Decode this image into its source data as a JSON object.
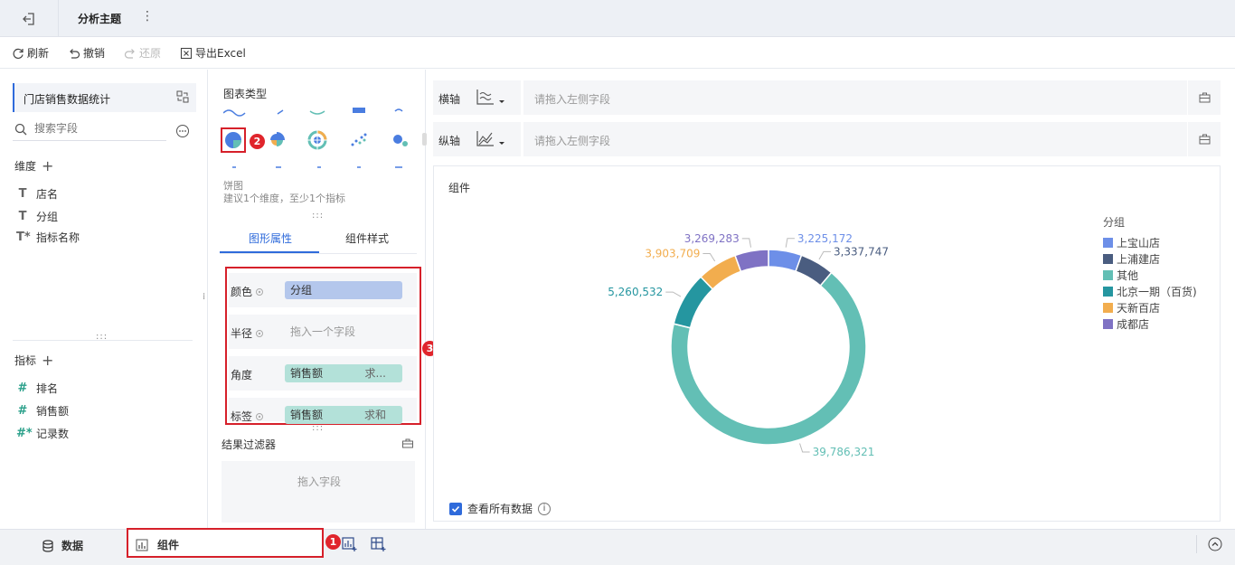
{
  "header": {
    "title": "分析主题",
    "more": "⋮"
  },
  "toolbar": {
    "refresh": "刷新",
    "undo": "撤销",
    "redo": "还原",
    "export": "导出Excel"
  },
  "left": {
    "dataset": "门店销售数据统计",
    "search_placeholder": "搜索字段",
    "dimensions_title": "维度",
    "dimensions": [
      {
        "icon": "T",
        "label": "店名"
      },
      {
        "icon": "T",
        "label": "分组"
      },
      {
        "icon": "T*",
        "label": "指标名称"
      }
    ],
    "metrics_title": "指标",
    "metrics": [
      {
        "icon": "#",
        "label": "排名"
      },
      {
        "icon": "#",
        "label": "销售额"
      },
      {
        "icon": "#*",
        "label": "记录数"
      }
    ]
  },
  "middle": {
    "chart_type_label": "图表类型",
    "selected_chart": "饼图",
    "chart_hint": "建议1个维度，至少1个指标",
    "tabs": [
      "图形属性",
      "组件样式"
    ],
    "props": [
      {
        "label": "颜色",
        "value": "分组",
        "agg": ""
      },
      {
        "label": "半径",
        "value": "拖入一个字段",
        "agg": ""
      },
      {
        "label": "角度",
        "value": "销售额",
        "agg": "求..."
      },
      {
        "label": "标签",
        "value": "销售额",
        "agg": "求和"
      }
    ],
    "filter_title": "结果过滤器",
    "filter_placeholder": "拖入字段",
    "badge2": "2",
    "badge3": "3"
  },
  "axes": {
    "x_label": "横轴",
    "y_label": "纵轴",
    "placeholder": "请拖入左侧字段"
  },
  "canvas": {
    "title": "组件",
    "show_all": "查看所有数据",
    "legend_title": "分组"
  },
  "chart_data": {
    "type": "pie",
    "donut": true,
    "categories": [
      "上宝山店",
      "上浦建店",
      "其他",
      "北京一期（百货)",
      "天新百店",
      "成都店"
    ],
    "values": [
      3225172,
      3337747,
      39786321,
      5260532,
      3903709,
      3269283
    ],
    "labels": [
      "3,225,172",
      "3,337,747",
      "39,786,321",
      "5,260,532",
      "3,903,709",
      "3,269,283"
    ],
    "colors": [
      "#6d8fe8",
      "#4a5d80",
      "#63bfb5",
      "#2596a0",
      "#f2ad4e",
      "#7f72c4"
    ],
    "legend_title": "分组",
    "legend_position": "right"
  },
  "bottom": {
    "data_tab": "数据",
    "component_tab": "组件",
    "badge1": "1"
  }
}
